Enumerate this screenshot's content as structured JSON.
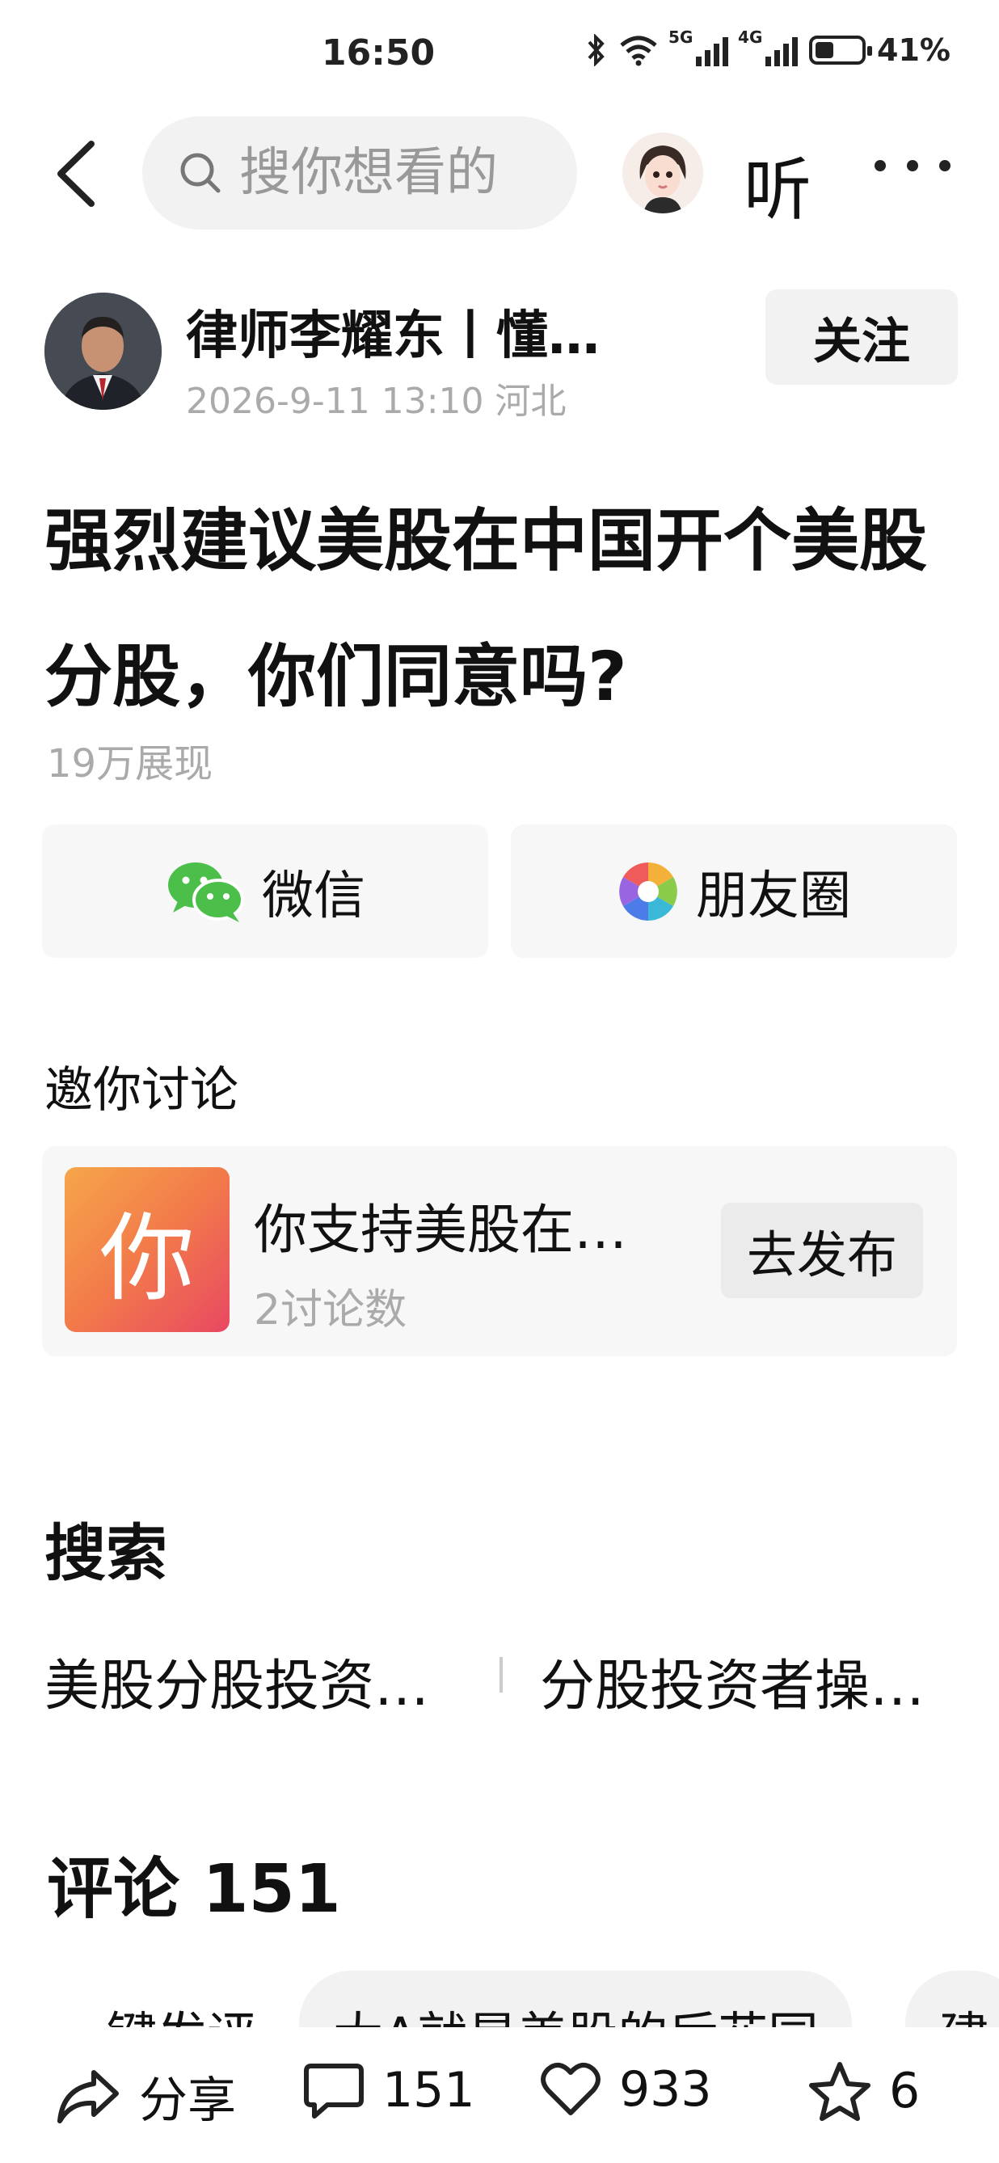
{
  "status_bar": {
    "time": "16:50",
    "net_5g": "5G",
    "net_4g": "4G",
    "battery": "41%"
  },
  "nav": {
    "search_placeholder": "搜你想看的",
    "listen_label": "听"
  },
  "author": {
    "name": "律师李耀东丨懂…",
    "meta": "2026-9-11 13:10 河北",
    "follow_label": "关注"
  },
  "article": {
    "title": "强烈建议美股在中国开个美股分股，你们同意吗?",
    "views": "19万展现"
  },
  "share": {
    "wechat_label": "微信",
    "moments_label": "朋友圈"
  },
  "discussion": {
    "section_label": "邀你讨论",
    "icon_char": "你",
    "title": "你支持美股在…",
    "count": "2讨论数",
    "publish_label": "去发布"
  },
  "search": {
    "heading": "搜索",
    "suggestions": [
      "美股分股投资…",
      "分股投资者操…"
    ]
  },
  "comments": {
    "heading": "评论 151",
    "chips": [
      "一键发评",
      "大A就是美股的后花园",
      "建"
    ]
  },
  "actions": {
    "share_label": "分享",
    "comment_count": "151",
    "like_count": "933",
    "fav_count": "6"
  },
  "colors": {
    "wechat_green": "#4cbf4b",
    "muted_text": "#aaaaaa",
    "button_bg": "#f2f2f3"
  }
}
